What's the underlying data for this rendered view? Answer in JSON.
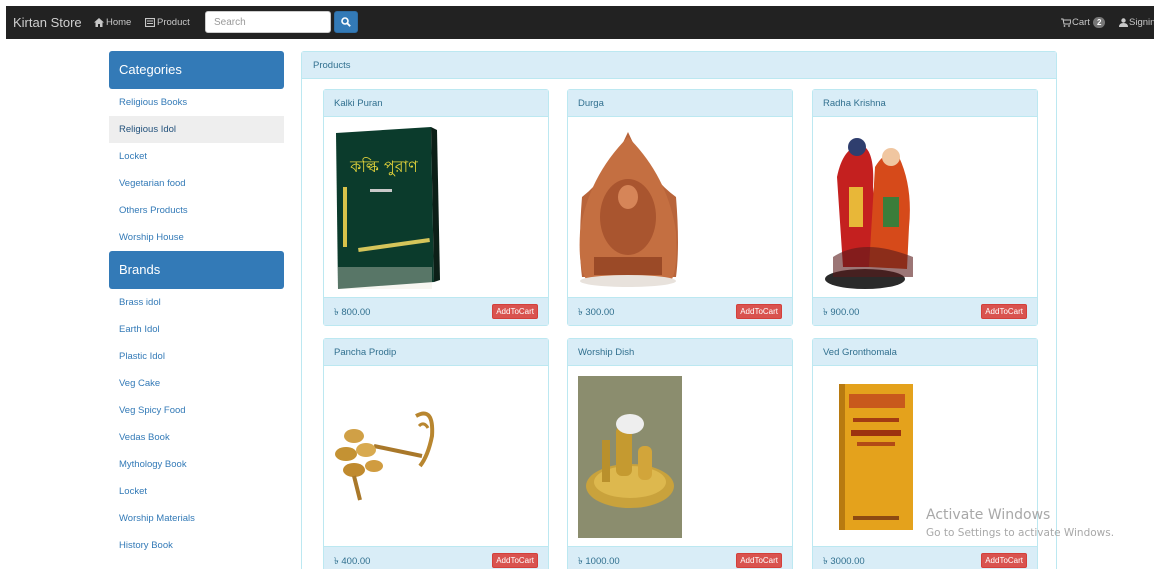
{
  "navbar": {
    "brand": "Kirtan Store",
    "home_label": "Home",
    "product_label": "Product",
    "search_placeholder": "Search",
    "cart_label": "Cart",
    "cart_count": "2",
    "signin_label": "Signin",
    "icons": {
      "home": "home-icon",
      "product": "list-icon",
      "search": "search-icon",
      "cart": "cart-icon",
      "user": "user-icon"
    }
  },
  "sidebar": {
    "categories_title": "Categories",
    "categories": [
      {
        "label": "Religious Books"
      },
      {
        "label": "Religious Idol",
        "active": true
      },
      {
        "label": "Locket"
      },
      {
        "label": "Vegetarian food"
      },
      {
        "label": "Others Products"
      },
      {
        "label": "Worship House"
      }
    ],
    "brands_title": "Brands",
    "brands": [
      {
        "label": "Brass idol"
      },
      {
        "label": "Earth Idol"
      },
      {
        "label": "Plastic Idol"
      },
      {
        "label": "Veg Cake"
      },
      {
        "label": "Veg Spicy Food"
      },
      {
        "label": "Vedas Book"
      },
      {
        "label": "Mythology Book"
      },
      {
        "label": "Locket"
      },
      {
        "label": "Worship Materials"
      },
      {
        "label": "History Book"
      }
    ]
  },
  "products_panel": {
    "title": "Products",
    "items": [
      {
        "name": "Kalki Puran",
        "price": "৳ 800.00",
        "button": "AddToCart",
        "image": "book-cover-image",
        "image_text": "কল্কি পুরাণ"
      },
      {
        "name": "Durga",
        "price": "৳ 300.00",
        "button": "AddToCart",
        "image": "terracotta-idol-image"
      },
      {
        "name": "Radha Krishna",
        "price": "৳ 900.00",
        "button": "AddToCart",
        "image": "idol-statue-image"
      },
      {
        "name": "Pancha Prodip",
        "price": "৳ 400.00",
        "button": "AddToCart",
        "image": "brass-lamp-image"
      },
      {
        "name": "Worship Dish",
        "price": "৳ 1000.00",
        "button": "AddToCart",
        "image": "brass-dish-image"
      },
      {
        "name": "Ved Gronthomala",
        "price": "৳ 3000.00",
        "button": "AddToCart",
        "image": "book-cover-image"
      }
    ]
  },
  "watermark": {
    "line1": "Activate Windows",
    "line2": "Go to Settings to activate Windows."
  },
  "colors": {
    "navbar": "#222222",
    "primary": "#337ab7",
    "info_bg": "#d9edf7",
    "info_border": "#bce8f1",
    "danger": "#d9534f"
  }
}
